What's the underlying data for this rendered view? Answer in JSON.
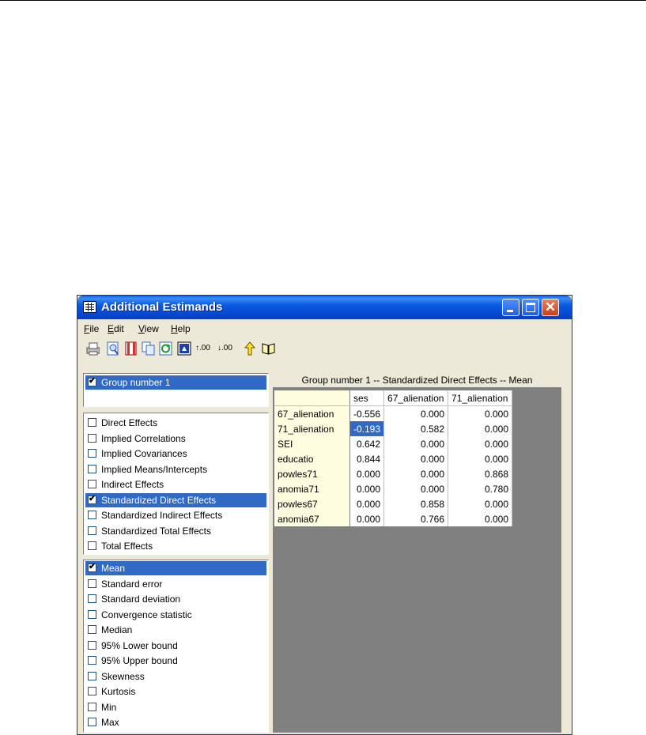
{
  "window": {
    "title": "Additional Estimands"
  },
  "menu": [
    {
      "label": "File",
      "u": "F",
      "rest": "ile"
    },
    {
      "label": "Edit",
      "u": "E",
      "rest": "dit"
    },
    {
      "label": "View",
      "u": "V",
      "rest": "iew"
    },
    {
      "label": "Help",
      "u": "H",
      "rest": "elp"
    }
  ],
  "toolbar": [
    "print-icon",
    "print-preview-icon",
    "page-setup-icon",
    "copy-icon",
    "refresh-icon",
    "full-screen-icon",
    "increase-decimals-icon",
    "decrease-decimals-icon",
    "up-one-level-icon",
    "help-book-icon"
  ],
  "groups": [
    {
      "label": "Group number 1",
      "checked": true
    }
  ],
  "estimand_types": [
    {
      "label": "Direct Effects",
      "checked": false
    },
    {
      "label": "Implied Correlations",
      "checked": false
    },
    {
      "label": "Implied Covariances",
      "checked": false
    },
    {
      "label": "Implied Means/Intercepts",
      "checked": false
    },
    {
      "label": "Indirect Effects",
      "checked": false
    },
    {
      "label": "Standardized Direct Effects",
      "checked": true
    },
    {
      "label": "Standardized Indirect Effects",
      "checked": false
    },
    {
      "label": "Standardized Total Effects",
      "checked": false
    },
    {
      "label": "Total Effects",
      "checked": false
    }
  ],
  "statistics": [
    {
      "label": "Mean",
      "checked": true
    },
    {
      "label": "Standard error",
      "checked": false
    },
    {
      "label": "Standard deviation",
      "checked": false
    },
    {
      "label": "Convergence statistic",
      "checked": false
    },
    {
      "label": "Median",
      "checked": false
    },
    {
      "label": "95% Lower bound",
      "checked": false
    },
    {
      "label": "95% Upper bound",
      "checked": false
    },
    {
      "label": "Skewness",
      "checked": false
    },
    {
      "label": "Kurtosis",
      "checked": false
    },
    {
      "label": "Min",
      "checked": false
    },
    {
      "label": "Max",
      "checked": false
    }
  ],
  "table": {
    "heading": "Group number 1 -- Standardized Direct Effects -- Mean",
    "columns": [
      "ses",
      "67_alienation",
      "71_alienation"
    ],
    "rows": [
      {
        "label": "67_alienation",
        "values": [
          "-0.556",
          "0.000",
          "0.000"
        ]
      },
      {
        "label": "71_alienation",
        "values": [
          "-0.193",
          "0.582",
          "0.000"
        ]
      },
      {
        "label": "SEI",
        "values": [
          "0.642",
          "0.000",
          "0.000"
        ]
      },
      {
        "label": "educatio",
        "values": [
          "0.844",
          "0.000",
          "0.000"
        ]
      },
      {
        "label": "powles71",
        "values": [
          "0.000",
          "0.000",
          "0.868"
        ]
      },
      {
        "label": "anomia71",
        "values": [
          "0.000",
          "0.000",
          "0.780"
        ]
      },
      {
        "label": "powles67",
        "values": [
          "0.000",
          "0.858",
          "0.000"
        ]
      },
      {
        "label": "anomia67",
        "values": [
          "0.000",
          "0.766",
          "0.000"
        ]
      }
    ],
    "highlight_cell": "71_alienation/ses",
    "highlight_color": "#316ac5"
  }
}
